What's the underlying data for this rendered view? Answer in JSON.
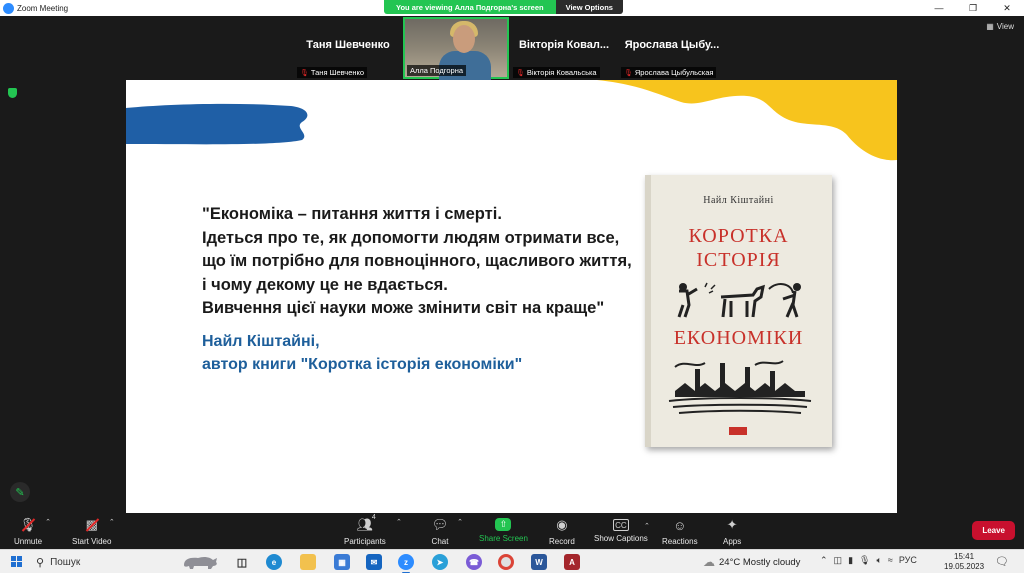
{
  "window": {
    "title": "Zoom Meeting"
  },
  "banner": {
    "viewing": "You are viewing Алла Подгорна's screen",
    "view_options": "View Options"
  },
  "view_label": "View",
  "participants_strip": [
    {
      "big": "Таня Шевченко",
      "label": "Таня Шевченко",
      "muted": true
    },
    {
      "big": "",
      "label": "Алла Подгорна",
      "muted": false,
      "video": true
    },
    {
      "big": "Вікторія  Ковал...",
      "label": "Вікторія Ковальська",
      "muted": true
    },
    {
      "big": "Ярослава  Цыбу...",
      "label": "Ярослава Цыбульская",
      "muted": true
    }
  ],
  "slide": {
    "quote_lines": [
      "\"Економіка – питання життя і смерті.",
      "Ідеться про те, як допомогти людям отримати все,",
      "що їм потрібно для повноцінного, щасливого життя,",
      "і чому декому це не вдається.",
      "Вивчення цієї науки може змінити світ на краще\""
    ],
    "author_lines": [
      "Найл Кіштайні,",
      "автор книги \"Коротка історія економіки\""
    ],
    "book": {
      "author": "Найл Кіштайні",
      "title_1": "Коротка",
      "title_2": "історія",
      "title_3": "економіки"
    },
    "colors": {
      "blue": "#1f5fa6",
      "yellow": "#f7c41d",
      "title_red": "#c8312a"
    }
  },
  "toolbar": {
    "unmute": "Unmute",
    "start_video": "Start Video",
    "participants": "Participants",
    "participants_count": "4",
    "chat": "Chat",
    "share_screen": "Share Screen",
    "record": "Record",
    "show_captions": "Show Captions",
    "reactions": "Reactions",
    "apps": "Apps",
    "leave": "Leave"
  },
  "taskbar": {
    "search": "Пошук",
    "weather": "24°C  Mostly cloudy",
    "lang": "РУС",
    "time": "15:41",
    "date": "19.05.2023"
  }
}
